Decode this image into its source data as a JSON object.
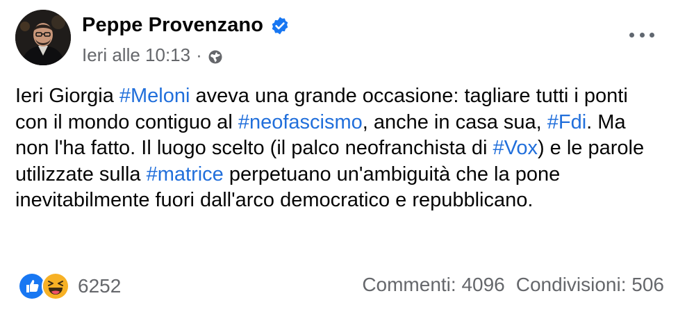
{
  "author": {
    "name": "Peppe Provenzano",
    "verified_icon": "verified-badge-icon",
    "avatar_icon": "profile-avatar"
  },
  "meta": {
    "time": "Ieri alle 10:13",
    "separator": "·",
    "audience_icon": "globe-icon"
  },
  "more_icon": "more-options-icon",
  "post": {
    "segments": [
      {
        "text": "Ieri Giorgia ",
        "hashtag": false
      },
      {
        "text": "#Meloni",
        "hashtag": true
      },
      {
        "text": " aveva una grande occasione: tagliare tutti i ponti con il mondo contiguo al ",
        "hashtag": false
      },
      {
        "text": "#neofascismo",
        "hashtag": true
      },
      {
        "text": ", anche in casa sua, ",
        "hashtag": false
      },
      {
        "text": "#Fdi",
        "hashtag": true
      },
      {
        "text": ". Ma non l'ha fatto. Il luogo scelto (il palco neofranchista di ",
        "hashtag": false
      },
      {
        "text": "#Vox",
        "hashtag": true
      },
      {
        "text": ") e le parole utilizzate sulla ",
        "hashtag": false
      },
      {
        "text": "#matrice",
        "hashtag": true
      },
      {
        "text": " perpetuano un'ambiguità che la pone inevitabilmente fuori dall'arco democratico e repubblicano.",
        "hashtag": false
      }
    ]
  },
  "reactions": {
    "icons": [
      "like-reaction-icon",
      "haha-reaction-icon"
    ],
    "count": "6252"
  },
  "stats": {
    "comments": "Commenti: 4096",
    "shares": "Condivisioni: 506"
  },
  "colors": {
    "hashtag": "#216fdb",
    "secondary_text": "#65676b",
    "verified": "#1877f2",
    "like": "#1877f2",
    "haha": "#f7b125"
  }
}
